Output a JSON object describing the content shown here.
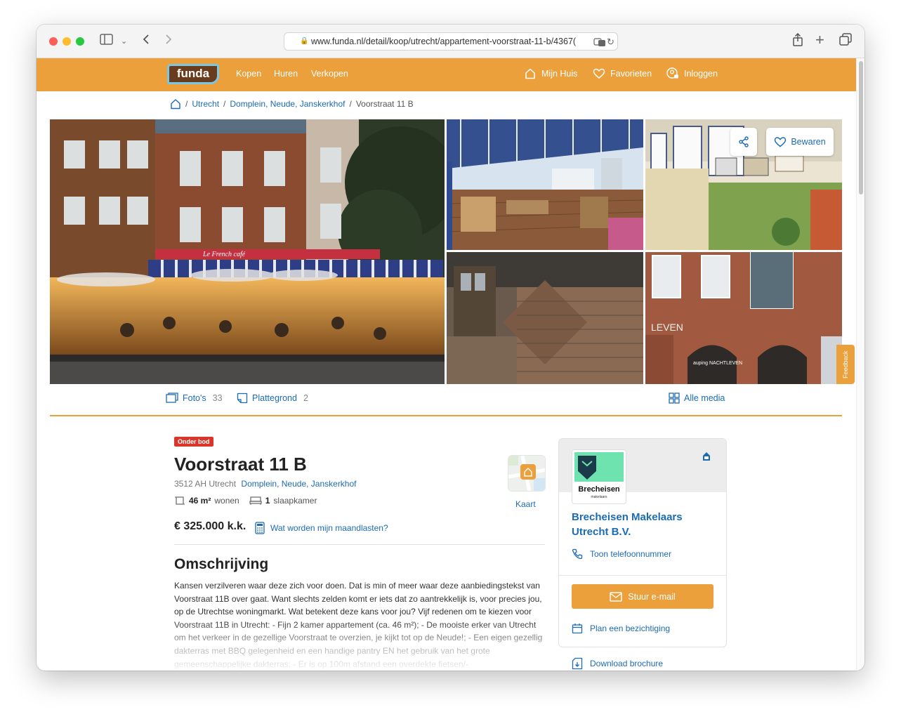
{
  "browser": {
    "url": "www.funda.nl/detail/koop/utrecht/appartement-voorstraat-11-b/4367("
  },
  "header": {
    "logo": "funda",
    "nav": [
      "Kopen",
      "Huren",
      "Verkopen"
    ],
    "my_house": "Mijn Huis",
    "favorites": "Favorieten",
    "login": "Inloggen",
    "accent": "#eba03c"
  },
  "breadcrumb": {
    "separator": "/",
    "items": [
      "Utrecht",
      "Domplein, Neude, Janskerkhof",
      "Voorstraat 11 B"
    ]
  },
  "gallery": {
    "save_label": "Bewaren",
    "cafe_sign": "Le French café",
    "facade_text": "LEVEN",
    "shop_text": "auping NACHTLEVEN",
    "feedback_label": "Feedback"
  },
  "media": {
    "photos_label": "Foto's",
    "photos_count": "33",
    "floorplan_label": "Plattegrond",
    "floorplan_count": "2",
    "all_media": "Alle media"
  },
  "listing": {
    "status_badge": "Onder bod",
    "title": "Voorstraat 11 B",
    "postcode_city": "3512 AH Utrecht",
    "neighbourhood": "Domplein, Neude, Janskerkhof",
    "living_area_value": "46 m²",
    "living_area_label": "wonen",
    "bedrooms_value": "1",
    "bedrooms_label": "slaapkamer",
    "price": "€ 325.000 k.k.",
    "monthly_costs_link": "Wat worden mijn maandlasten?",
    "map_label": "Kaart",
    "description_title": "Omschrijving",
    "description": "Kansen verzilveren waar deze zich voor doen. Dat is min of meer waar deze aanbiedingstekst van Voorstraat 11B over gaat. Want slechts zelden komt er iets dat zo aantrekkelijk is, voor precies jou, op de Utrechtse woningmarkt. Wat betekent deze kans voor jou? Vijf redenen om te kiezen voor Voorstraat 11B in Utrecht: - Fijn 2 kamer appartement (ca. 46 m²); - De mooiste erker van Utrecht om het verkeer in de gezellige Voorstraat te overzien, je kijkt tot op de Neude!; - Een eigen gezellig dakterras met BBQ gelegenheid en een handige pantry EN het gebruik van het grote gemeenschappelijke dakterras; - Er is op 100m afstand een overdekte fietsen/-"
  },
  "agent": {
    "logo_text": "Brecheisen",
    "logo_subtext": "makelaars",
    "name": "Brecheisen Makelaars Utrecht B.V.",
    "phone_link": "Toon telefoonnummer",
    "email_button": "Stuur e-mail",
    "viewing_link": "Plan een bezichtiging",
    "brochure_link": "Download brochure"
  }
}
